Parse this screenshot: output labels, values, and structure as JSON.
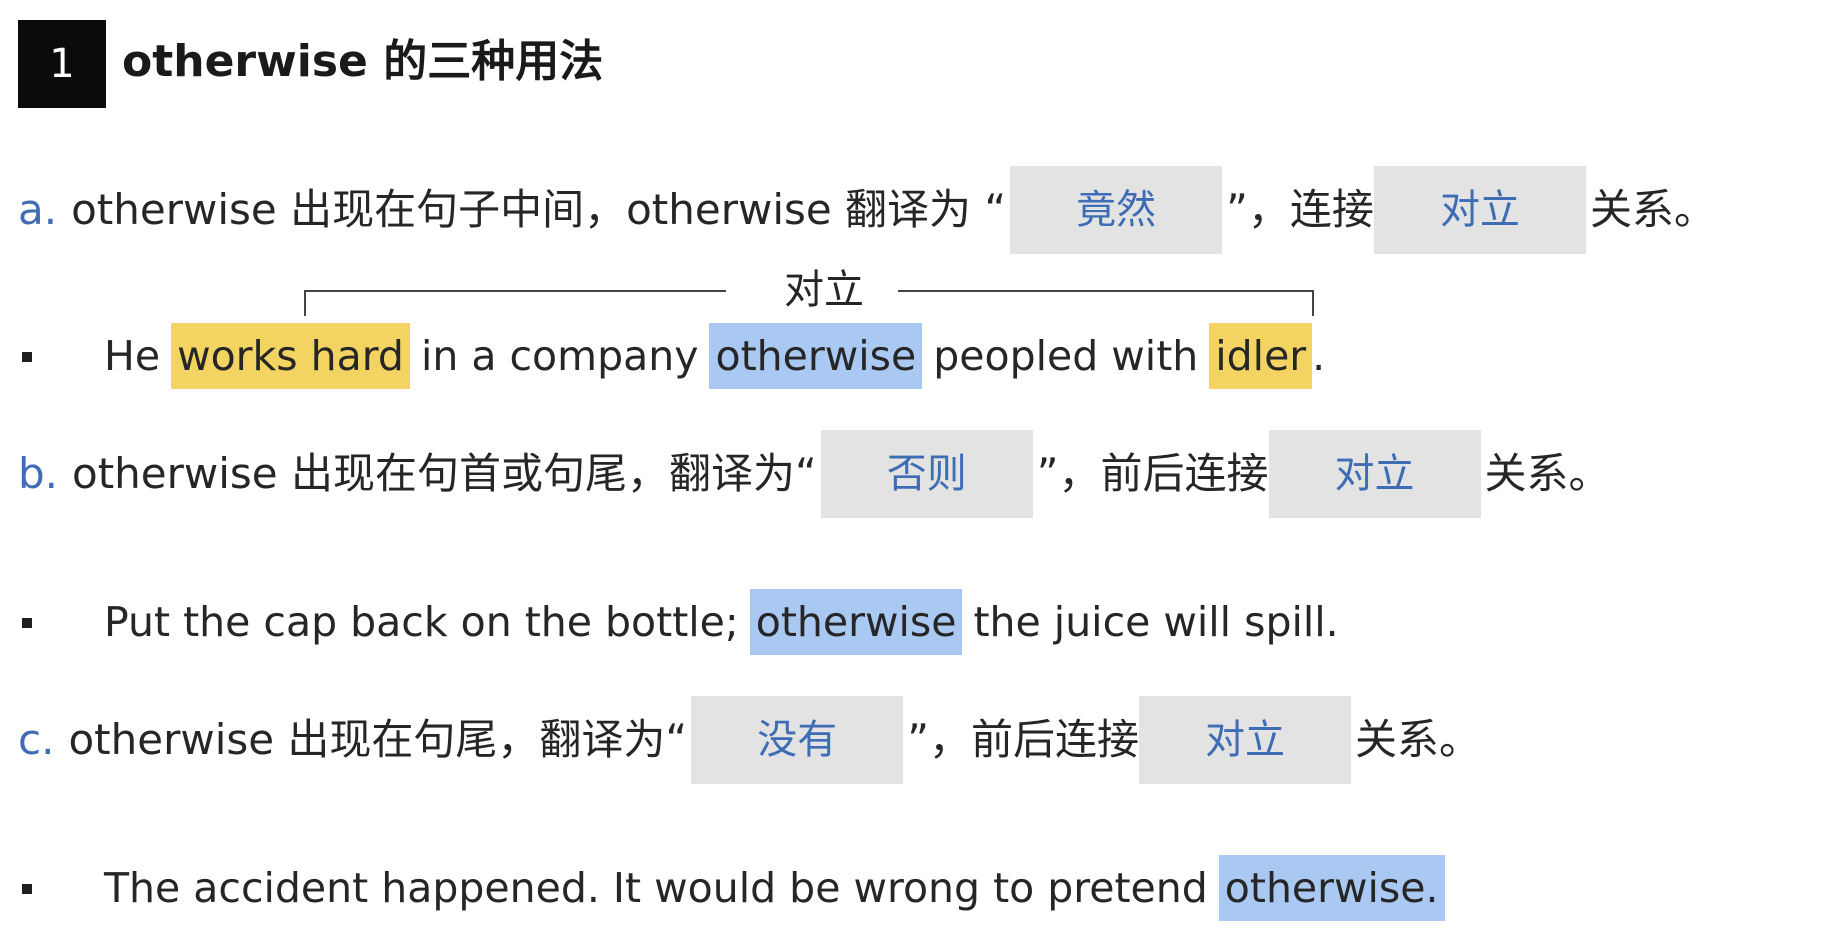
{
  "header": {
    "number": "1",
    "title": "otherwise 的三种用法"
  },
  "rules": [
    {
      "letter": "a.",
      "text1": "otherwise 出现在句子中间，otherwise 翻译为 “",
      "answer1": "竟然",
      "text2": "”，连接",
      "answer2": "对立",
      "text3": "关系。"
    },
    {
      "letter": "b.",
      "text1": "otherwise 出现在句首或句尾，翻译为“",
      "answer1": "否则",
      "text2": "”，前后连接",
      "answer2": "对立",
      "text3": "关系。"
    },
    {
      "letter": "c.",
      "text1": "otherwise 出现在句尾，翻译为“",
      "answer1": "没有",
      "text2": "”，前后连接",
      "answer2": "对立",
      "text3": "关系。"
    }
  ],
  "annotation": {
    "label": "对立"
  },
  "examples": [
    {
      "parts": {
        "p1": "He",
        "hl1": "works hard",
        "p2": "in a company",
        "hl2": "otherwise",
        "p3": "peopled with",
        "hl3": "idler",
        "p4": "."
      }
    },
    {
      "parts": {
        "p1": "Put the cap back on the bottle;",
        "hl1": "otherwise",
        "p2": "the juice will spill."
      }
    },
    {
      "parts": {
        "p1": "The accident happened. It would be wrong to pretend",
        "hl1": "otherwise."
      }
    }
  ],
  "colors": {
    "accent_blue_text": "#3f6db5",
    "highlight_yellow": "#f3d462",
    "highlight_blue": "#a9c8f2",
    "answer_box_gray": "#e3e3e3"
  }
}
